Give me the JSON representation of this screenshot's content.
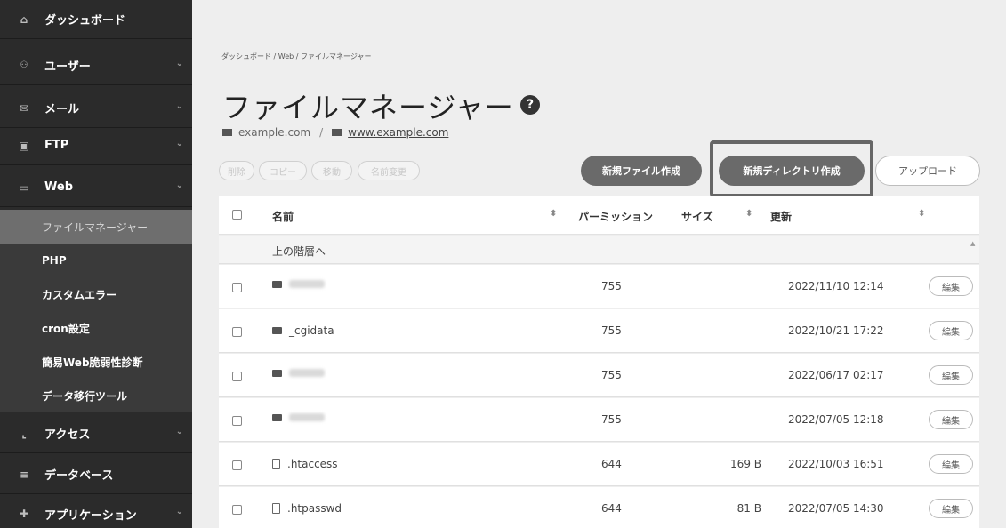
{
  "sidebar": {
    "items": [
      {
        "label": "ダッシュボード",
        "icon": "home-icon",
        "glyph": "⌂",
        "chevron": false
      },
      {
        "label": "ユーザー",
        "icon": "users-icon",
        "glyph": "👥",
        "chevron": true
      },
      {
        "label": "メール",
        "icon": "mail-icon",
        "glyph": "✉",
        "chevron": true
      },
      {
        "label": "FTP",
        "icon": "ftp-icon",
        "glyph": "▣",
        "chevron": true
      },
      {
        "label": "Web",
        "icon": "web-window-icon",
        "glyph": "▭",
        "chevron": true
      }
    ],
    "sub_items": [
      {
        "label": "ファイルマネージャー",
        "active": true
      },
      {
        "label": "PHP",
        "active": false
      },
      {
        "label": "カスタムエラー",
        "active": false
      },
      {
        "label": "cron設定",
        "active": false
      },
      {
        "label": "簡易Web脆弱性診断",
        "active": false
      },
      {
        "label": "データ移行ツール",
        "active": false
      }
    ],
    "bottom_items": [
      {
        "label": "アクセス",
        "icon": "chart-icon",
        "glyph": "⌞",
        "chevron": true
      },
      {
        "label": "データベース",
        "icon": "database-icon",
        "glyph": "≡",
        "chevron": false
      },
      {
        "label": "アプリケーション",
        "icon": "app-icon",
        "glyph": "✚",
        "chevron": true
      }
    ],
    "chevron_glyph": "⌄"
  },
  "breadcrumb": "ダッシュボード / Web / ファイルマネージャー",
  "page_title": "ファイルマネージャー",
  "help_glyph": "?",
  "path": {
    "root": "example.com",
    "separator": "/",
    "current": "www.example.com"
  },
  "actions": {
    "delete": "削除",
    "copy": "コピー",
    "move": "移動",
    "rename": "名前変更",
    "new_file": "新規ファイル作成",
    "new_dir": "新規ディレクトリ作成",
    "upload": "アップロード"
  },
  "table": {
    "headers": {
      "name": "名前",
      "permission": "パーミッション",
      "size": "サイズ",
      "updated": "更新"
    },
    "sort_glyph": "⬍",
    "parent_label": "上の階層へ",
    "edit_label": "編集",
    "rows": [
      {
        "type": "folder",
        "name": "",
        "perm": "755",
        "size": "",
        "date": "2022/11/10 12:14"
      },
      {
        "type": "folder",
        "name": "_cgidata",
        "perm": "755",
        "size": "",
        "date": "2022/10/21 17:22"
      },
      {
        "type": "folder",
        "name": "",
        "perm": "755",
        "size": "",
        "date": "2022/06/17 02:17"
      },
      {
        "type": "folder",
        "name": "",
        "perm": "755",
        "size": "",
        "date": "2022/07/05 12:18"
      },
      {
        "type": "file",
        "name": ".htaccess",
        "perm": "644",
        "size": "169 B",
        "date": "2022/10/03 16:51"
      },
      {
        "type": "file",
        "name": ".htpasswd",
        "perm": "644",
        "size": "81 B",
        "date": "2022/07/05 14:30"
      }
    ]
  }
}
